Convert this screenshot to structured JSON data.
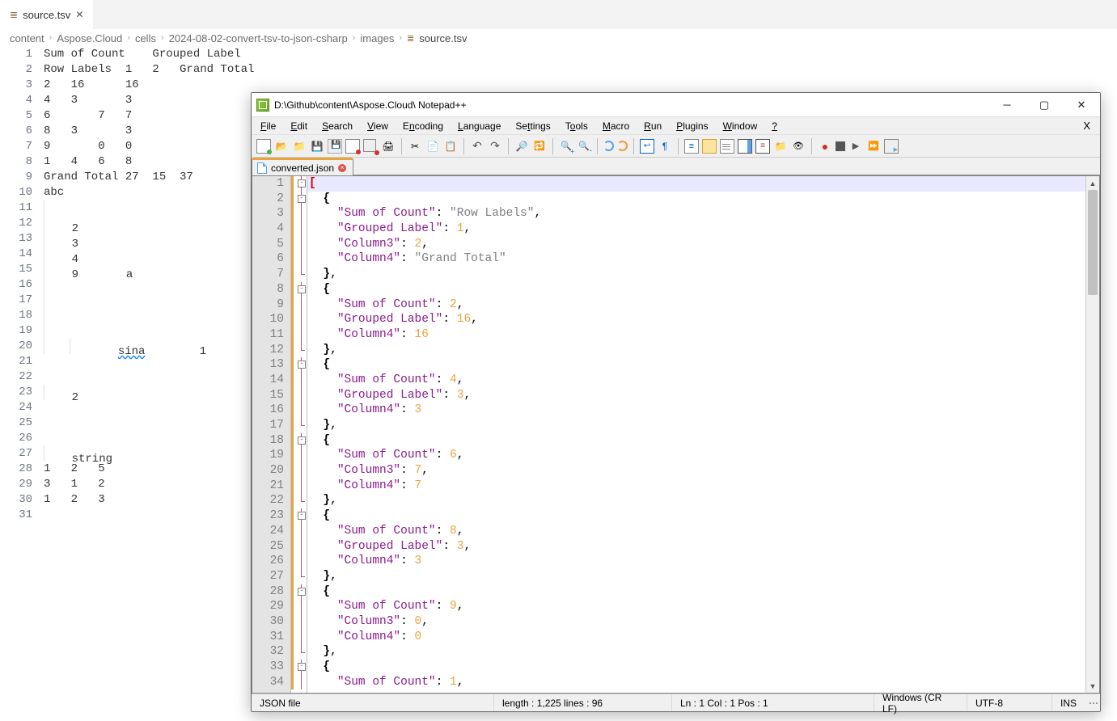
{
  "vscode": {
    "tab": {
      "name": "source.tsv"
    },
    "breadcrumbs": [
      "content",
      "Aspose.Cloud",
      "cells",
      "2024-08-02-convert-tsv-to-json-csharp",
      "images",
      "source.tsv"
    ],
    "lines": [
      "Sum of Count    Grouped Label",
      "Row Labels  1   2   Grand Total",
      "2   16      16",
      "4   3       3",
      "6       7   7",
      "8   3       3",
      "9       0   0",
      "1   4   6   8",
      "Grand Total 27  15  37",
      "abc",
      "",
      "    2",
      "    3",
      "    4",
      "    9       a",
      "",
      "",
      "",
      "",
      "        sina        1",
      "",
      "",
      "    2",
      "",
      "",
      "",
      "    string",
      "1   2   5",
      "3   1   2",
      "1   2   3",
      ""
    ]
  },
  "npp": {
    "titlePath": "D:\\Github\\content\\Aspose.Cloud\\  Notepad++",
    "menu": {
      "file": "File",
      "edit": "Edit",
      "search": "Search",
      "view": "View",
      "encoding": "Encoding",
      "language": "Language",
      "settings": "Settings",
      "tools": "Tools",
      "macro": "Macro",
      "run": "Run",
      "plugins": "Plugins",
      "window": "Window",
      "help": "?"
    },
    "docTab": "converted.json",
    "code": [
      {
        "t": "[",
        "fold": "box",
        "mod": true,
        "cur": true,
        "parts": [
          {
            "c": "brM",
            "v": "["
          }
        ]
      },
      {
        "fold": "box",
        "mod": true,
        "parts": [
          {
            "v": "  "
          },
          {
            "c": "br",
            "v": "{"
          }
        ]
      },
      {
        "fold": "line",
        "mod": true,
        "parts": [
          {
            "v": "    "
          },
          {
            "c": "key",
            "v": "\"Sum of Count\""
          },
          {
            "v": ": "
          },
          {
            "c": "str",
            "v": "\"Row Labels\""
          },
          {
            "v": ","
          }
        ]
      },
      {
        "fold": "line",
        "mod": true,
        "parts": [
          {
            "v": "    "
          },
          {
            "c": "key",
            "v": "\"Grouped Label\""
          },
          {
            "v": ": "
          },
          {
            "c": "num",
            "v": "1"
          },
          {
            "v": ","
          }
        ]
      },
      {
        "fold": "line",
        "mod": true,
        "parts": [
          {
            "v": "    "
          },
          {
            "c": "key",
            "v": "\"Column3\""
          },
          {
            "v": ": "
          },
          {
            "c": "num",
            "v": "2"
          },
          {
            "v": ","
          }
        ]
      },
      {
        "fold": "line",
        "mod": true,
        "parts": [
          {
            "v": "    "
          },
          {
            "c": "key",
            "v": "\"Column4\""
          },
          {
            "v": ": "
          },
          {
            "c": "str",
            "v": "\"Grand Total\""
          }
        ]
      },
      {
        "fold": "end",
        "mod": true,
        "parts": [
          {
            "v": "  "
          },
          {
            "c": "br",
            "v": "}"
          },
          {
            "v": ","
          }
        ]
      },
      {
        "fold": "box",
        "mod": true,
        "parts": [
          {
            "v": "  "
          },
          {
            "c": "br",
            "v": "{"
          }
        ]
      },
      {
        "fold": "line",
        "mod": true,
        "parts": [
          {
            "v": "    "
          },
          {
            "c": "key",
            "v": "\"Sum of Count\""
          },
          {
            "v": ": "
          },
          {
            "c": "num",
            "v": "2"
          },
          {
            "v": ","
          }
        ]
      },
      {
        "fold": "line",
        "mod": true,
        "parts": [
          {
            "v": "    "
          },
          {
            "c": "key",
            "v": "\"Grouped Label\""
          },
          {
            "v": ": "
          },
          {
            "c": "num",
            "v": "16"
          },
          {
            "v": ","
          }
        ]
      },
      {
        "fold": "line",
        "mod": true,
        "parts": [
          {
            "v": "    "
          },
          {
            "c": "key",
            "v": "\"Column4\""
          },
          {
            "v": ": "
          },
          {
            "c": "num",
            "v": "16"
          }
        ]
      },
      {
        "fold": "end",
        "mod": true,
        "parts": [
          {
            "v": "  "
          },
          {
            "c": "br",
            "v": "}"
          },
          {
            "v": ","
          }
        ]
      },
      {
        "fold": "box",
        "mod": true,
        "parts": [
          {
            "v": "  "
          },
          {
            "c": "br",
            "v": "{"
          }
        ]
      },
      {
        "fold": "line",
        "mod": true,
        "parts": [
          {
            "v": "    "
          },
          {
            "c": "key",
            "v": "\"Sum of Count\""
          },
          {
            "v": ": "
          },
          {
            "c": "num",
            "v": "4"
          },
          {
            "v": ","
          }
        ]
      },
      {
        "fold": "line",
        "mod": true,
        "parts": [
          {
            "v": "    "
          },
          {
            "c": "key",
            "v": "\"Grouped Label\""
          },
          {
            "v": ": "
          },
          {
            "c": "num",
            "v": "3"
          },
          {
            "v": ","
          }
        ]
      },
      {
        "fold": "line",
        "mod": true,
        "parts": [
          {
            "v": "    "
          },
          {
            "c": "key",
            "v": "\"Column4\""
          },
          {
            "v": ": "
          },
          {
            "c": "num",
            "v": "3"
          }
        ]
      },
      {
        "fold": "end",
        "mod": true,
        "parts": [
          {
            "v": "  "
          },
          {
            "c": "br",
            "v": "}"
          },
          {
            "v": ","
          }
        ]
      },
      {
        "fold": "box",
        "mod": true,
        "parts": [
          {
            "v": "  "
          },
          {
            "c": "br",
            "v": "{"
          }
        ]
      },
      {
        "fold": "line",
        "mod": true,
        "parts": [
          {
            "v": "    "
          },
          {
            "c": "key",
            "v": "\"Sum of Count\""
          },
          {
            "v": ": "
          },
          {
            "c": "num",
            "v": "6"
          },
          {
            "v": ","
          }
        ]
      },
      {
        "fold": "line",
        "mod": true,
        "parts": [
          {
            "v": "    "
          },
          {
            "c": "key",
            "v": "\"Column3\""
          },
          {
            "v": ": "
          },
          {
            "c": "num",
            "v": "7"
          },
          {
            "v": ","
          }
        ]
      },
      {
        "fold": "line",
        "mod": true,
        "parts": [
          {
            "v": "    "
          },
          {
            "c": "key",
            "v": "\"Column4\""
          },
          {
            "v": ": "
          },
          {
            "c": "num",
            "v": "7"
          }
        ]
      },
      {
        "fold": "end",
        "mod": true,
        "parts": [
          {
            "v": "  "
          },
          {
            "c": "br",
            "v": "}"
          },
          {
            "v": ","
          }
        ]
      },
      {
        "fold": "box",
        "mod": true,
        "parts": [
          {
            "v": "  "
          },
          {
            "c": "br",
            "v": "{"
          }
        ]
      },
      {
        "fold": "line",
        "mod": true,
        "parts": [
          {
            "v": "    "
          },
          {
            "c": "key",
            "v": "\"Sum of Count\""
          },
          {
            "v": ": "
          },
          {
            "c": "num",
            "v": "8"
          },
          {
            "v": ","
          }
        ]
      },
      {
        "fold": "line",
        "mod": true,
        "parts": [
          {
            "v": "    "
          },
          {
            "c": "key",
            "v": "\"Grouped Label\""
          },
          {
            "v": ": "
          },
          {
            "c": "num",
            "v": "3"
          },
          {
            "v": ","
          }
        ]
      },
      {
        "fold": "line",
        "mod": true,
        "parts": [
          {
            "v": "    "
          },
          {
            "c": "key",
            "v": "\"Column4\""
          },
          {
            "v": ": "
          },
          {
            "c": "num",
            "v": "3"
          }
        ]
      },
      {
        "fold": "end",
        "mod": true,
        "parts": [
          {
            "v": "  "
          },
          {
            "c": "br",
            "v": "}"
          },
          {
            "v": ","
          }
        ]
      },
      {
        "fold": "box",
        "mod": true,
        "parts": [
          {
            "v": "  "
          },
          {
            "c": "br",
            "v": "{"
          }
        ]
      },
      {
        "fold": "line",
        "mod": true,
        "parts": [
          {
            "v": "    "
          },
          {
            "c": "key",
            "v": "\"Sum of Count\""
          },
          {
            "v": ": "
          },
          {
            "c": "num",
            "v": "9"
          },
          {
            "v": ","
          }
        ]
      },
      {
        "fold": "line",
        "mod": true,
        "parts": [
          {
            "v": "    "
          },
          {
            "c": "key",
            "v": "\"Column3\""
          },
          {
            "v": ": "
          },
          {
            "c": "num",
            "v": "0"
          },
          {
            "v": ","
          }
        ]
      },
      {
        "fold": "line",
        "mod": true,
        "parts": [
          {
            "v": "    "
          },
          {
            "c": "key",
            "v": "\"Column4\""
          },
          {
            "v": ": "
          },
          {
            "c": "num",
            "v": "0"
          }
        ]
      },
      {
        "fold": "end",
        "mod": true,
        "parts": [
          {
            "v": "  "
          },
          {
            "c": "br",
            "v": "}"
          },
          {
            "v": ","
          }
        ]
      },
      {
        "fold": "box",
        "mod": true,
        "parts": [
          {
            "v": "  "
          },
          {
            "c": "br",
            "v": "{"
          }
        ]
      },
      {
        "fold": "line",
        "mod": true,
        "parts": [
          {
            "v": "    "
          },
          {
            "c": "key",
            "v": "\"Sum of Count\""
          },
          {
            "v": ": "
          },
          {
            "c": "num",
            "v": "1"
          },
          {
            "v": ","
          }
        ]
      }
    ],
    "status": {
      "type": "JSON file",
      "length": "length : 1,225    lines : 96",
      "pos": "Ln : 1    Col : 1    Pos : 1",
      "eol": "Windows (CR LF)",
      "enc": "UTF-8",
      "ins": "INS"
    }
  }
}
